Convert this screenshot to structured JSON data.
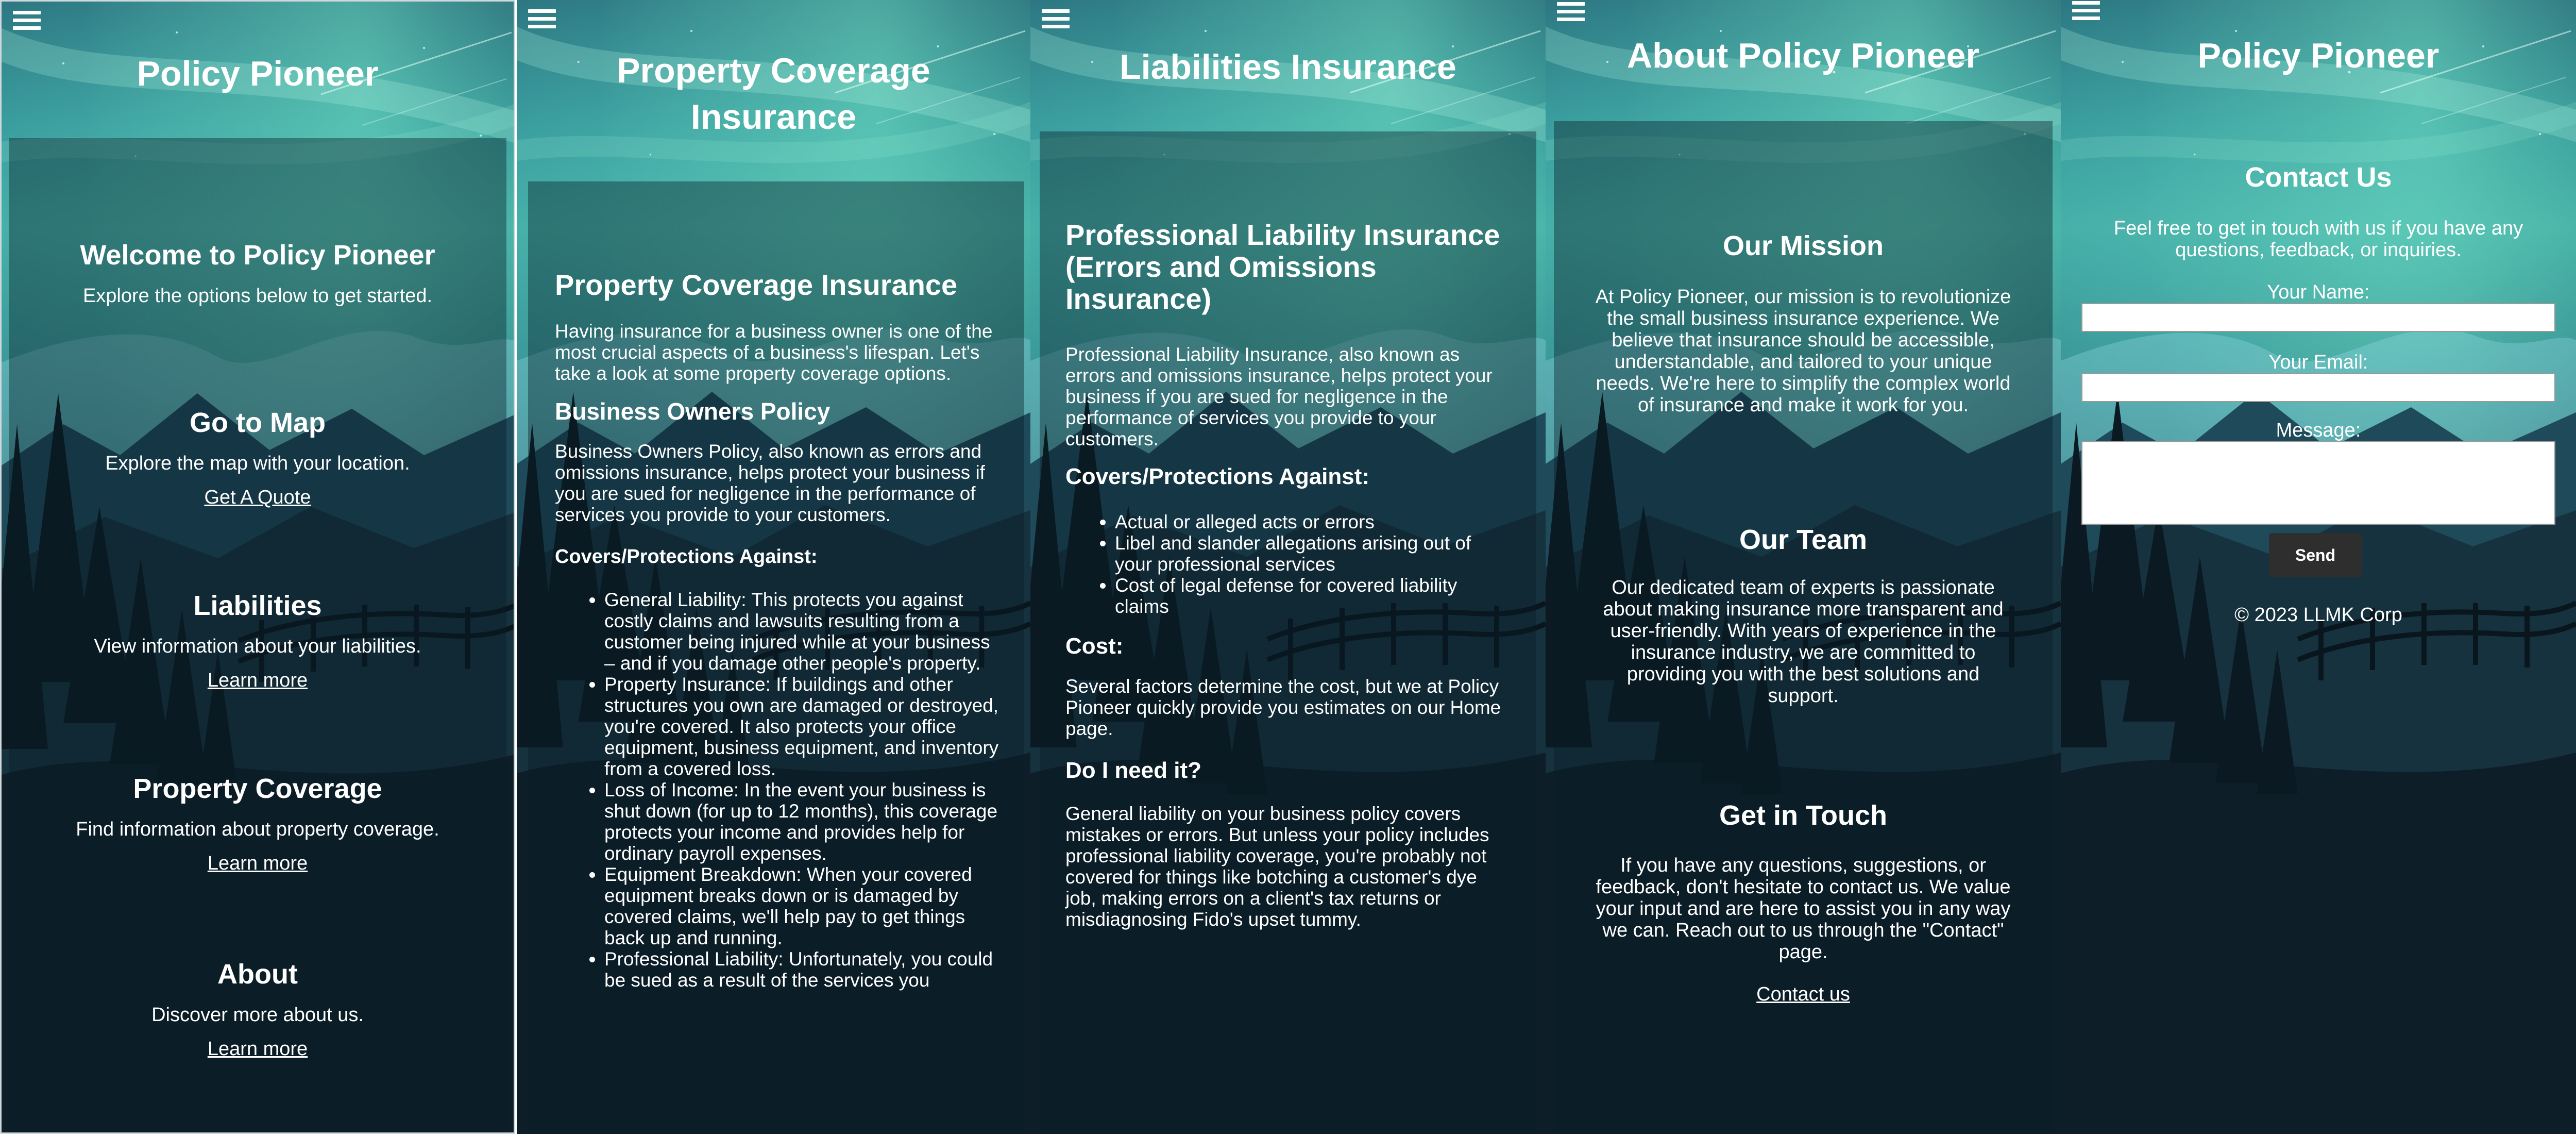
{
  "screens": {
    "home": {
      "title": "Policy Pioneer",
      "welcome_heading": "Welcome to Policy Pioneer",
      "welcome_text": "Explore the options below to get started.",
      "sections": [
        {
          "heading": "Go to Map",
          "text": "Explore the map with your location.",
          "link": "Get A Quote"
        },
        {
          "heading": "Liabilities",
          "text": "View information about your liabilities.",
          "link": "Learn more"
        },
        {
          "heading": "Property Coverage",
          "text": "Find information about property coverage.",
          "link": "Learn more"
        },
        {
          "heading": "About",
          "text": "Discover more about us.",
          "link": "Learn more"
        }
      ]
    },
    "property": {
      "title_line1": "Property Coverage",
      "title_line2": "Insurance",
      "heading": "Property Coverage Insurance",
      "intro": "Having insurance for a business owner is one of the most crucial aspects of a business's lifespan. Let's take a look at some property coverage options.",
      "sub_heading": "Business Owners Policy",
      "sub_text": "Business Owners Policy, also known as errors and omissions insurance, helps protect your business if you are sued for negligence in the performance of services you provide to your customers.",
      "covers_heading": "Covers/Protections Against:",
      "covers": [
        "General Liability: This protects you against costly claims and lawsuits resulting from a customer being injured while at your business – and if you damage other people's property.",
        "Property Insurance: If buildings and other structures you own are damaged or destroyed, you're covered. It also protects your office equipment, business equipment, and inventory from a covered loss.",
        "Loss of Income: In the event your business is shut down (for up to 12 months), this coverage protects your income and provides help for ordinary payroll expenses.",
        "Equipment Breakdown: When your covered equipment breaks down or is damaged by covered claims, we'll help pay to get things back up and running.",
        "Professional Liability: Unfortunately, you could be sued as a result of the services you"
      ]
    },
    "liabilities": {
      "title": "Liabilities Insurance",
      "heading": "Professional Liability Insurance (Errors and Omissions Insurance)",
      "intro": "Professional Liability Insurance, also known as errors and omissions insurance, helps protect your business if you are sued for negligence in the performance of services you provide to your customers.",
      "covers_heading": "Covers/Protections Against:",
      "covers": [
        "Actual or alleged acts or errors",
        "Libel and slander allegations arising out of your professional services",
        "Cost of legal defense for covered liability claims"
      ],
      "cost_heading": "Cost:",
      "cost_text": "Several factors determine the cost, but we at Policy Pioneer quickly provide you estimates on our Home page.",
      "need_heading": "Do I need it?",
      "need_text": "General liability on your business policy covers mistakes or errors. But unless your policy includes professional liability coverage, you're probably not covered for things like botching a customer's dye job, making errors on a client's tax returns or misdiagnosing Fido's upset tummy."
    },
    "about": {
      "title": "About Policy Pioneer",
      "mission_heading": "Our Mission",
      "mission_text": "At Policy Pioneer, our mission is to revolutionize the small business insurance experience. We believe that insurance should be accessible, understandable, and tailored to your unique needs. We're here to simplify the complex world of insurance and make it work for you.",
      "team_heading": "Our Team",
      "team_text": "Our dedicated team of experts is passionate about making insurance more transparent and user-friendly. With years of experience in the insurance industry, we are committed to providing you with the best solutions and support.",
      "touch_heading": "Get in Touch",
      "touch_text": "If you have any questions, suggestions, or feedback, don't hesitate to contact us. We value your input and are here to assist you in any way we can. Reach out to us through the \"Contact\" page.",
      "touch_link": "Contact us"
    },
    "contact": {
      "title": "Policy Pioneer",
      "heading": "Contact Us",
      "intro": "Feel free to get in touch with us if you have any questions, feedback, or inquiries.",
      "name_label": "Your Name:",
      "email_label": "Your Email:",
      "message_label": "Message:",
      "send_label": "Send",
      "footer": "© 2023 LLMK Corp"
    }
  },
  "icons": {
    "menu": "hamburger-menu-icon"
  },
  "colors": {
    "text": "#ffffff",
    "send_button": "#2e2e2e",
    "panel_overlay": "rgba(8,28,38,0.40)"
  }
}
